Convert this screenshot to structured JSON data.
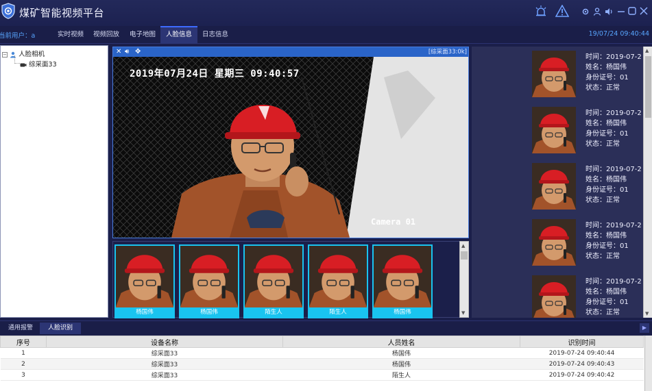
{
  "app": {
    "title": "煤矿智能视频平台",
    "icons": [
      "shield-logo-icon",
      "alarm-light-icon",
      "warning-icon",
      "settings-icon",
      "user-icon",
      "volume-icon",
      "minimize-icon",
      "maximize-icon",
      "close-icon"
    ]
  },
  "menubar": {
    "current_user": "当前用户：a",
    "items": [
      {
        "label": "实时视频"
      },
      {
        "label": "视频回放"
      },
      {
        "label": "电子地图"
      },
      {
        "label": "人脸信息",
        "active": true
      },
      {
        "label": "日志信息"
      }
    ],
    "datetime": "19/07/24 09:40:44"
  },
  "device_tree": {
    "root_label": "人脸相机",
    "child_label": "综采面33"
  },
  "video": {
    "label": "[综采面33:0k]",
    "osd_time": "2019年07月24日 星期三 09:40:57",
    "osd_camera": "Camera 01"
  },
  "thumbnails": [
    {
      "name": "杨国伟"
    },
    {
      "name": "杨国伟"
    },
    {
      "name": "陌生人"
    },
    {
      "name": "陌生人"
    },
    {
      "name": "杨国伟"
    }
  ],
  "results": [
    {
      "time": "时间：2019-07-2",
      "name": "姓名：杨国伟",
      "id": "身份证号：01",
      "status": "状态：正常"
    },
    {
      "time": "时间：2019-07-2",
      "name": "姓名：杨国伟",
      "id": "身份证号：01",
      "status": "状态：正常"
    },
    {
      "time": "时间：2019-07-2",
      "name": "姓名：杨国伟",
      "id": "身份证号：01",
      "status": "状态：正常"
    },
    {
      "time": "时间：2019-07-2",
      "name": "姓名：杨国伟",
      "id": "身份证号：01",
      "status": "状态：正常"
    },
    {
      "time": "时间：2019-07-2",
      "name": "姓名：杨国伟",
      "id": "身份证号：01",
      "status": "状态：正常"
    }
  ],
  "bottom_tabs": [
    {
      "label": "通用报警"
    },
    {
      "label": "人脸识别",
      "active": true
    }
  ],
  "table": {
    "headers": [
      "序号",
      "设备名称",
      "人员姓名",
      "识别时间"
    ],
    "rows": [
      [
        "1",
        "综采面33",
        "杨国伟",
        "2019-07-24 09:40:44"
      ],
      [
        "2",
        "综采面33",
        "杨国伟",
        "2019-07-24 09:40:43"
      ],
      [
        "3",
        "综采面33",
        "陌生人",
        "2019-07-24 09:40:42"
      ]
    ]
  }
}
